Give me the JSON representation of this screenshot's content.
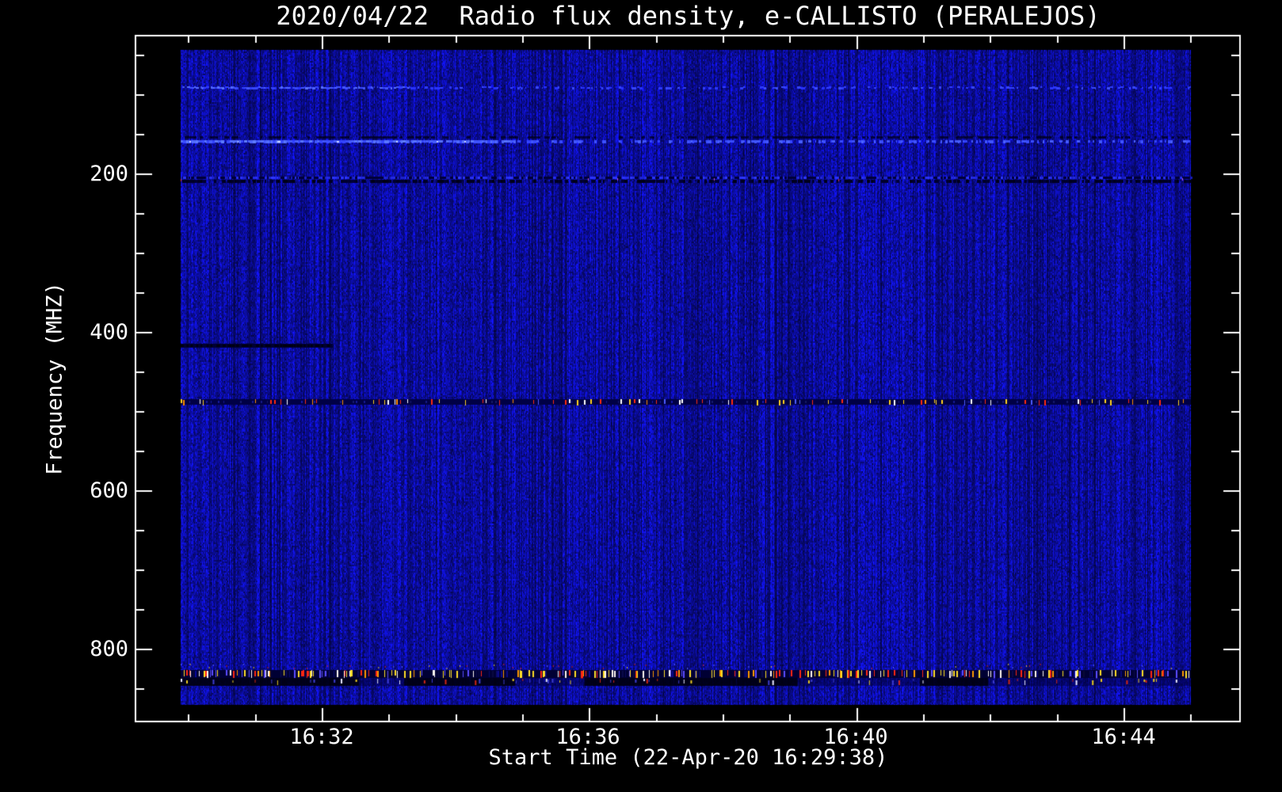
{
  "chart_data": {
    "type": "heatmap",
    "title": "2020/04/22  Radio flux density, e-CALLISTO (PERALEJOS)",
    "xlabel": "Start Time (22-Apr-20 16:29:38)",
    "ylabel": "Frequency (MHZ)",
    "x_tick_labels": [
      "16:32",
      "16:36",
      "16:40",
      "16:44"
    ],
    "x_minor_tick_interval_min": 1,
    "y_tick_labels": [
      "200",
      "400",
      "600",
      "800"
    ],
    "y_tick_values_mhz": [
      200,
      400,
      600,
      800
    ],
    "y_minor_tick_interval_mhz": 50,
    "y_axis_orientation": "frequency increases downward",
    "time_start": "16:29:38",
    "time_end": "16:45:05",
    "freq_range_mhz": [
      43,
      870
    ],
    "legend": "none",
    "grid": "off",
    "background_color": "#000000",
    "axis_color": "#ffffff",
    "noise_floor_color": "#0000a8",
    "colormap_note": "dark blue noise floor; bright blue = enhanced flux; red/yellow/white speckles = strong RFI",
    "rfi_features": [
      {
        "freq_mhz": 72,
        "kind": "bright blue horizontal line",
        "time_extent": "full sweep",
        "bright_until": "16:33:20"
      },
      {
        "freq_mhz": 137,
        "kind": "bright blue horizontal glow line with dark dashed edge above",
        "time_extent": "full sweep",
        "bright_until": "16:34:50"
      },
      {
        "freq_mhz": 187,
        "kind": "dark speckled interference band with faint magenta/red dots",
        "time_extent": "full sweep"
      },
      {
        "freq_mhz": 398,
        "kind": "dark absorption-like line segment",
        "time_extent": "16:29:38 to 16:32:10",
        "t_end": "16:32:10"
      },
      {
        "freq_mhz": 468,
        "kind": "speckled RFI line, red/yellow/white ticks on darkened row",
        "time_extent": "full sweep"
      },
      {
        "freq_mhz_range": [
          806,
          826
        ],
        "kind": "strong RFI band, dense yellow/red/white/orange bursts over dark and black patches",
        "time_extent": "full sweep"
      }
    ]
  }
}
